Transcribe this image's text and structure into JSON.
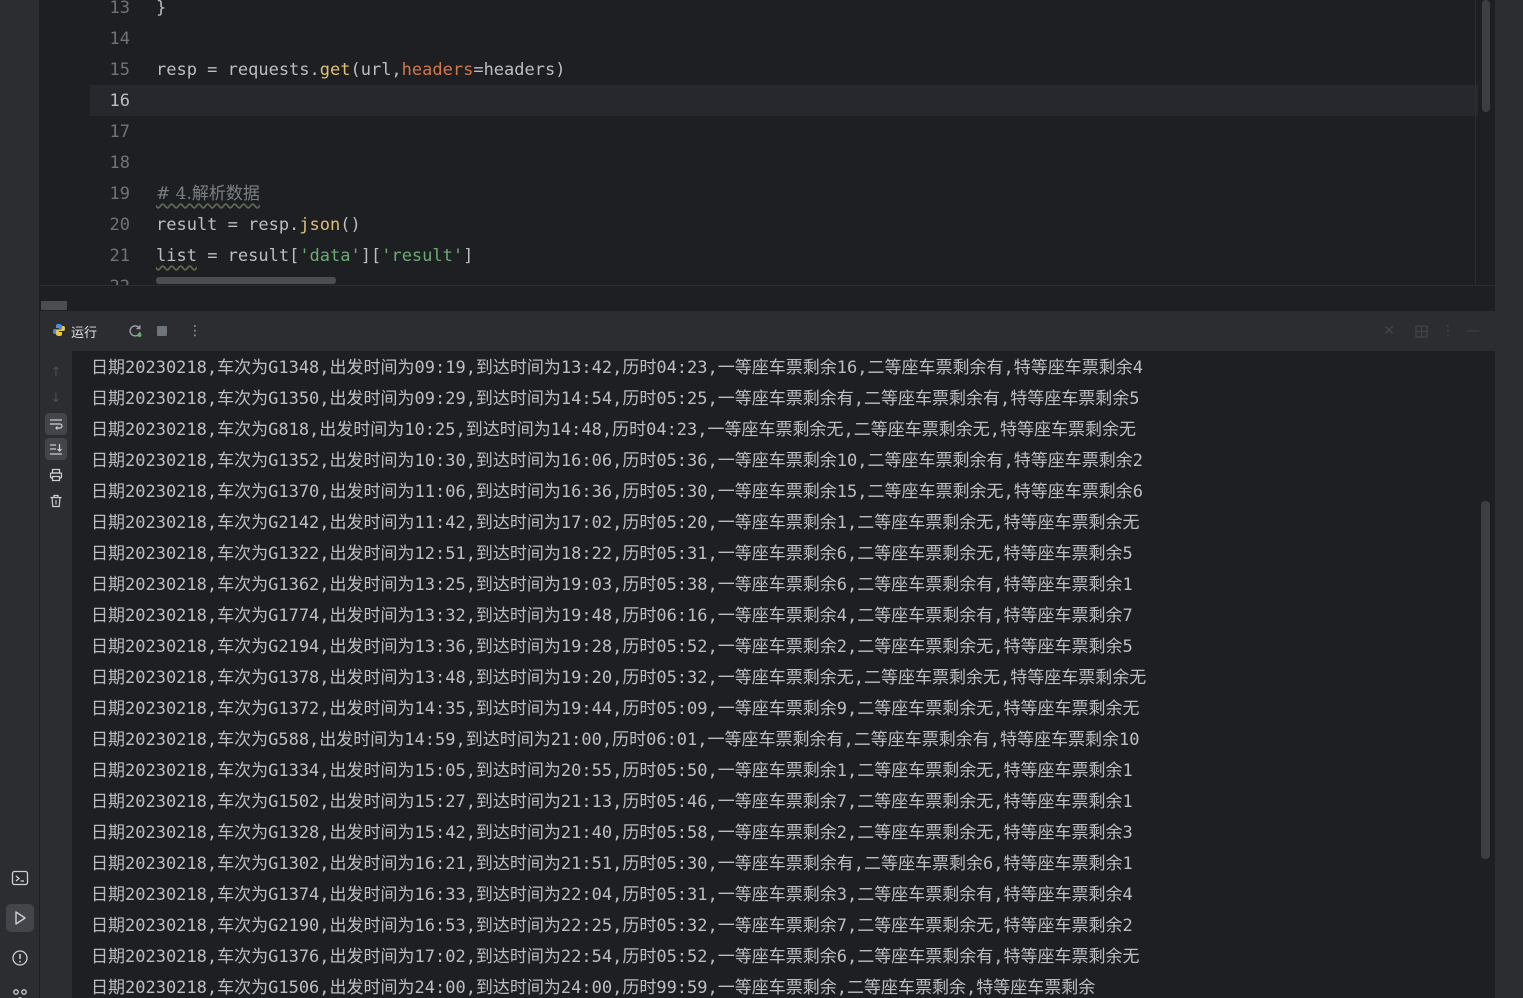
{
  "editor": {
    "lines": [
      {
        "num": "13",
        "segments": [
          {
            "text": "}",
            "cls": ""
          }
        ]
      },
      {
        "num": "14",
        "segments": []
      },
      {
        "num": "15",
        "segments": [
          {
            "text": "resp = requests.",
            "cls": ""
          },
          {
            "text": "get",
            "cls": "kw-fn"
          },
          {
            "text": "(url,",
            "cls": ""
          },
          {
            "text": "headers",
            "cls": "kw-param"
          },
          {
            "text": "=headers)",
            "cls": ""
          }
        ]
      },
      {
        "num": "16",
        "segments": [],
        "current": true
      },
      {
        "num": "17",
        "segments": []
      },
      {
        "num": "18",
        "segments": []
      },
      {
        "num": "19",
        "segments": [
          {
            "text": "# 4.解析数据",
            "cls": "comment"
          }
        ]
      },
      {
        "num": "20",
        "segments": [
          {
            "text": "result = resp.",
            "cls": ""
          },
          {
            "text": "json",
            "cls": "kw-fn"
          },
          {
            "text": "()",
            "cls": ""
          }
        ]
      },
      {
        "num": "21",
        "segments": [
          {
            "text": "list",
            "cls": "wavy"
          },
          {
            "text": " = result[",
            "cls": ""
          },
          {
            "text": "'data'",
            "cls": "str"
          },
          {
            "text": "][",
            "cls": ""
          },
          {
            "text": "'result'",
            "cls": "str"
          },
          {
            "text": "]",
            "cls": ""
          }
        ]
      },
      {
        "num": "22",
        "segments": []
      }
    ]
  },
  "run_panel": {
    "tab_label": "运行",
    "tab_icon": "python-icon",
    "toolbar_icons": [
      "rerun-icon",
      "stop-icon",
      "more-vertical-icon"
    ],
    "right_icons": [
      "close-icon",
      "layout-icon",
      "more-vertical-icon",
      "minimize-icon"
    ],
    "side_icons": [
      "arrow-up-icon",
      "arrow-down-icon",
      "soft-wrap-icon",
      "scroll-to-end-icon",
      "print-icon",
      "trash-icon"
    ]
  },
  "left_strip_icons": [
    "terminal-icon",
    "run-icon",
    "problems-icon",
    "vcs-icon"
  ],
  "console": {
    "lines": [
      "日期20230218,车次为G1348,出发时间为09:19,到达时间为13:42,历时04:23,一等座车票剩余16,二等座车票剩余有,特等座车票剩余4",
      "日期20230218,车次为G1350,出发时间为09:29,到达时间为14:54,历时05:25,一等座车票剩余有,二等座车票剩余有,特等座车票剩余5",
      "日期20230218,车次为G818,出发时间为10:25,到达时间为14:48,历时04:23,一等座车票剩余无,二等座车票剩余无,特等座车票剩余无",
      "日期20230218,车次为G1352,出发时间为10:30,到达时间为16:06,历时05:36,一等座车票剩余10,二等座车票剩余有,特等座车票剩余2",
      "日期20230218,车次为G1370,出发时间为11:06,到达时间为16:36,历时05:30,一等座车票剩余15,二等座车票剩余无,特等座车票剩余6",
      "日期20230218,车次为G2142,出发时间为11:42,到达时间为17:02,历时05:20,一等座车票剩余1,二等座车票剩余无,特等座车票剩余无",
      "日期20230218,车次为G1322,出发时间为12:51,到达时间为18:22,历时05:31,一等座车票剩余6,二等座车票剩余无,特等座车票剩余5",
      "日期20230218,车次为G1362,出发时间为13:25,到达时间为19:03,历时05:38,一等座车票剩余6,二等座车票剩余有,特等座车票剩余1",
      "日期20230218,车次为G1774,出发时间为13:32,到达时间为19:48,历时06:16,一等座车票剩余4,二等座车票剩余有,特等座车票剩余7",
      "日期20230218,车次为G2194,出发时间为13:36,到达时间为19:28,历时05:52,一等座车票剩余2,二等座车票剩余无,特等座车票剩余5",
      "日期20230218,车次为G1378,出发时间为13:48,到达时间为19:20,历时05:32,一等座车票剩余无,二等座车票剩余无,特等座车票剩余无",
      "日期20230218,车次为G1372,出发时间为14:35,到达时间为19:44,历时05:09,一等座车票剩余9,二等座车票剩余无,特等座车票剩余无",
      "日期20230218,车次为G588,出发时间为14:59,到达时间为21:00,历时06:01,一等座车票剩余有,二等座车票剩余有,特等座车票剩余10",
      "日期20230218,车次为G1334,出发时间为15:05,到达时间为20:55,历时05:50,一等座车票剩余1,二等座车票剩余无,特等座车票剩余1",
      "日期20230218,车次为G1502,出发时间为15:27,到达时间为21:13,历时05:46,一等座车票剩余7,二等座车票剩余无,特等座车票剩余1",
      "日期20230218,车次为G1328,出发时间为15:42,到达时间为21:40,历时05:58,一等座车票剩余2,二等座车票剩余无,特等座车票剩余3",
      "日期20230218,车次为G1302,出发时间为16:21,到达时间为21:51,历时05:30,一等座车票剩余有,二等座车票剩余6,特等座车票剩余1",
      "日期20230218,车次为G1374,出发时间为16:33,到达时间为22:04,历时05:31,一等座车票剩余3,二等座车票剩余有,特等座车票剩余4",
      "日期20230218,车次为G2190,出发时间为16:53,到达时间为22:25,历时05:32,一等座车票剩余7,二等座车票剩余无,特等座车票剩余2",
      "日期20230218,车次为G1376,出发时间为17:02,到达时间为22:54,历时05:52,一等座车票剩余6,二等座车票剩余有,特等座车票剩余无",
      "日期20230218,车次为G1506,出发时间为24:00,到达时间为24:00,历时99:59,一等座车票剩余,二等座车票剩余,特等座车票剩余"
    ]
  }
}
